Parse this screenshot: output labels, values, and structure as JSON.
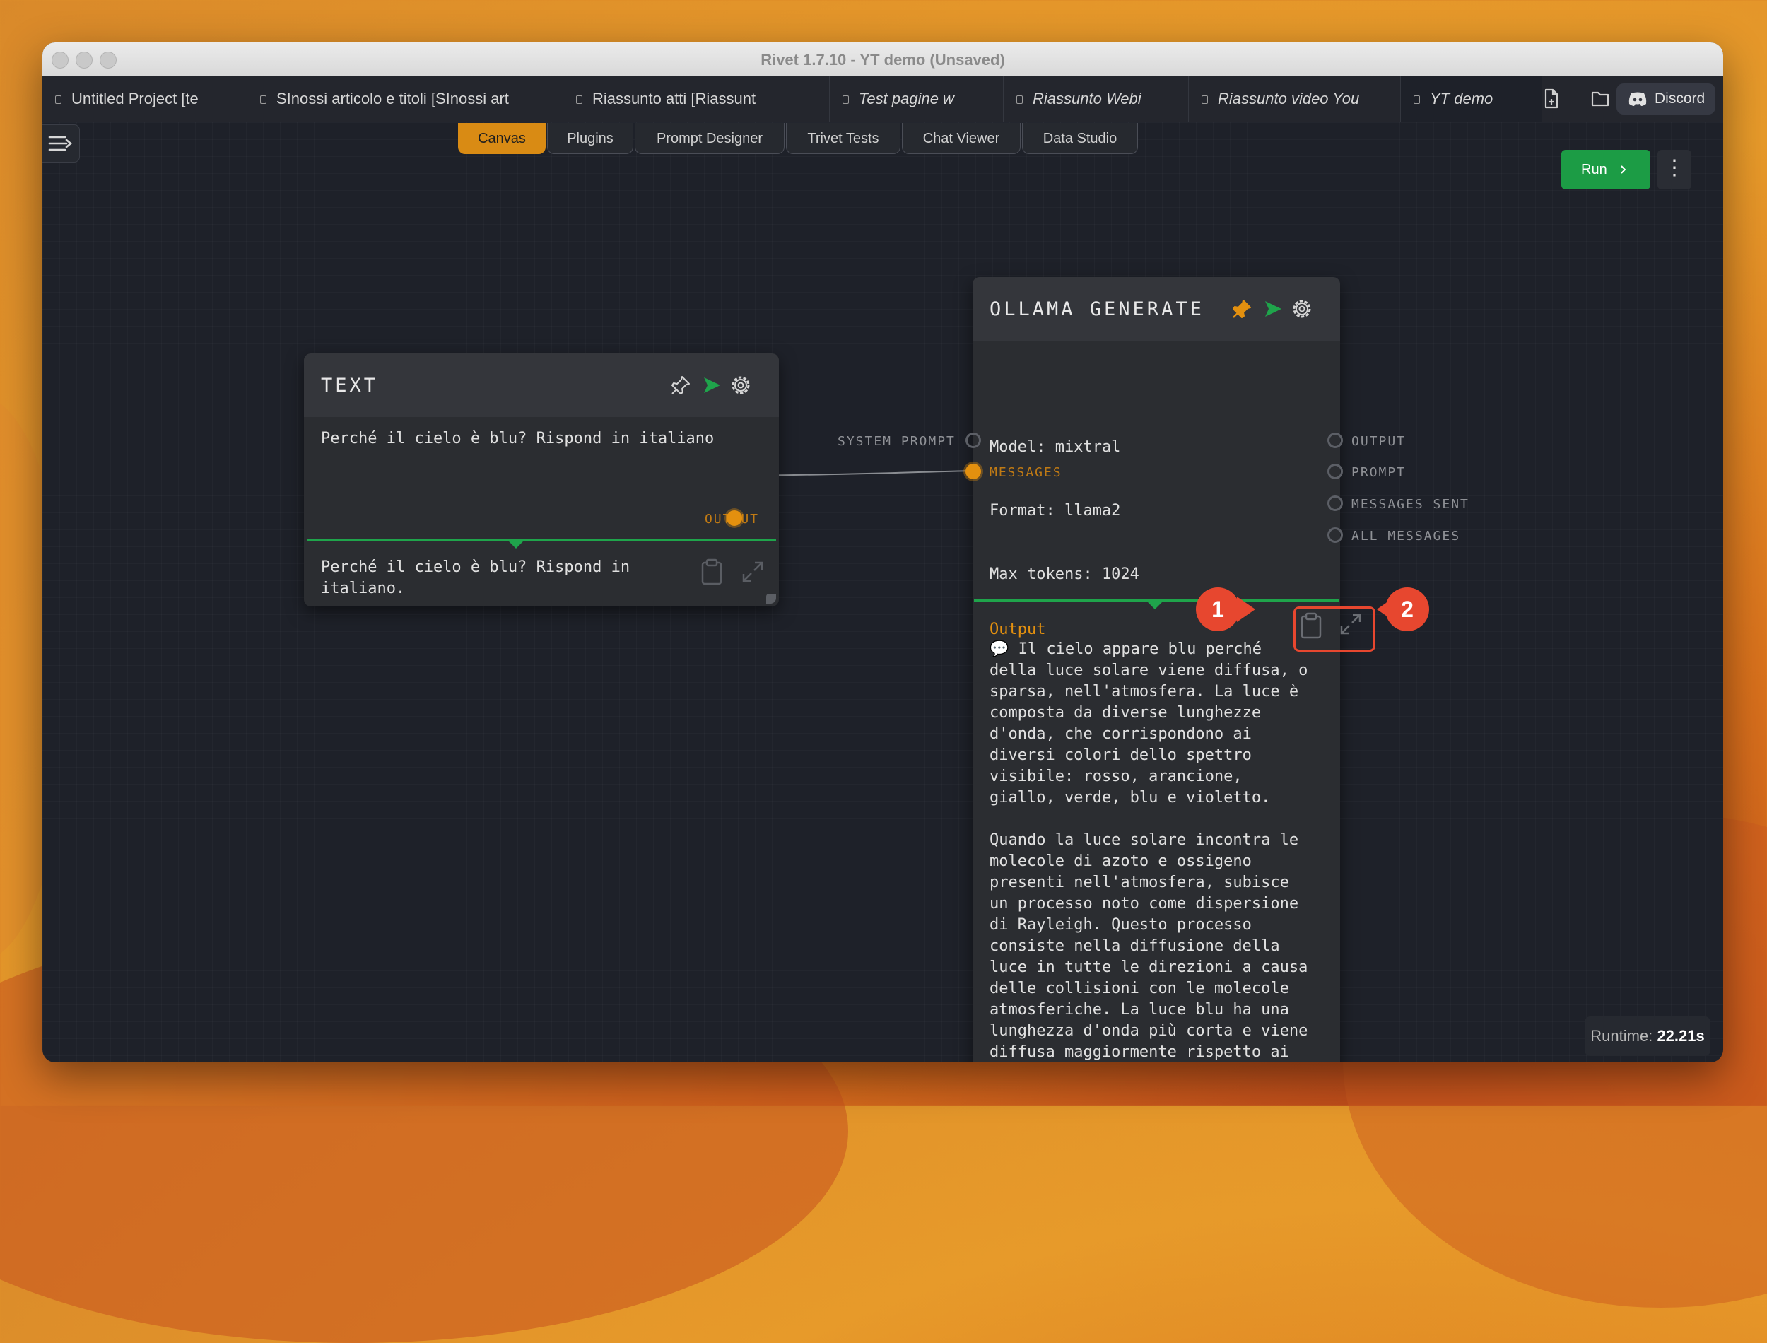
{
  "window": {
    "title": "Rivet 1.7.10 - YT demo (Unsaved)"
  },
  "tabs": [
    {
      "label": "Untitled Project [te"
    },
    {
      "label": "SInossi articolo e titoli [SInossi art"
    },
    {
      "label": "Riassunto atti [Riassunt"
    },
    {
      "label": "Test pagine w"
    },
    {
      "label": "Riassunto Webi"
    },
    {
      "label": "Riassunto video You"
    },
    {
      "label": "YT demo"
    }
  ],
  "toolbar": {
    "discord_label": "Discord"
  },
  "main_tabs": [
    "Canvas",
    "Plugins",
    "Prompt Designer",
    "Trivet Tests",
    "Chat Viewer",
    "Data Studio"
  ],
  "actions": {
    "run_label": "Run",
    "more_label": "⋮"
  },
  "text_node": {
    "title": "TEXT",
    "content": "Perché il cielo è blu? Rispond in italiano",
    "output_port": "OUTPUT",
    "output_preview": "Perché il cielo è blu? Rispond in\nitaliano."
  },
  "ollama_node": {
    "title": "OLLAMA GENERATE",
    "model_line": "Model: mixtral",
    "format_line": "Format: llama2",
    "tokens_line": "Max tokens: 1024",
    "inputs": [
      "SYSTEM PROMPT",
      "MESSAGES"
    ],
    "outputs": [
      "OUTPUT",
      "PROMPT",
      "MESSAGES SENT",
      "ALL MESSAGES"
    ],
    "output_label": "Output",
    "output_icon": "💬",
    "output_text": "Il cielo appare blu perché\ndella luce solare viene diffusa, o\nsparsa, nell'atmosfera. La luce è\ncomposta da diverse lunghezze\nd'onda, che corrispondono ai\ndiversi colori dello spettro\nvisibile: rosso, arancione,\ngiallo, verde, blu e violetto.\n\nQuando la luce solare incontra le\nmolecole di azoto e ossigeno\npresenti nell'atmosfera, subisce\nun processo noto come dispersione\ndi Rayleigh. Questo processo\nconsiste nella diffusione della\nluce in tutte le direzioni a causa\ndelle collisioni con le molecole\natmosferiche. La luce blu ha una\nlunghezza d'onda più corta e viene\ndiffusa maggiormente rispetto ai\ncolori con lunghezze d'onda più\nlunghe, come il rosso o"
  },
  "annotations": {
    "badge1": "1",
    "badge2": "2",
    "color": "#e7472f"
  },
  "runtime": {
    "label": "Runtime:",
    "value": "22.21s"
  },
  "colors": {
    "accent": "#d98b14",
    "run": "#1c9c45",
    "port_active": "#e3900f",
    "success": "#1fa44b"
  }
}
